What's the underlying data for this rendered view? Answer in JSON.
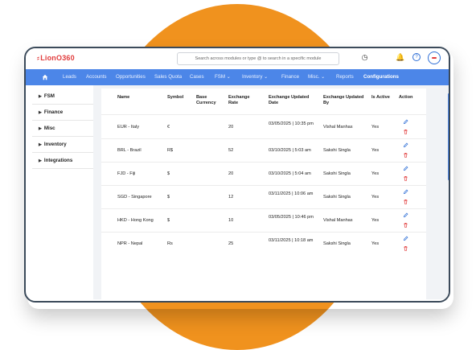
{
  "app": {
    "logo": "LionO360"
  },
  "search": {
    "placeholder": "Search across modules or type @ to search in a specific module"
  },
  "nav": [
    "Leads",
    "Accounts",
    "Opportunities",
    "Sales Quota",
    "Cases",
    "FSM",
    "Inventory",
    "Finance",
    "Misc.",
    "Reports",
    "Configurations"
  ],
  "nav_dropdowns": [
    "FSM",
    "Inventory",
    "Misc."
  ],
  "nav_active": "Configurations",
  "sidebar": [
    "FSM",
    "Finance",
    "Misc",
    "Inventory",
    "Integrations"
  ],
  "table": {
    "headers": [
      "Name",
      "Symbol",
      "Base Currency",
      "Exchange Rate",
      "Exchange Updated Date",
      "Exchange Updated By",
      "Is Active",
      "Action"
    ],
    "rows": [
      {
        "name": "EUR - Italy",
        "symbol": "€",
        "base": "",
        "rate": "20",
        "date": "03/05/2025 | 10:35 pm",
        "by": "Vishal Manhas",
        "active": "Yes"
      },
      {
        "name": "BRL - Brazil",
        "symbol": "R$",
        "base": "",
        "rate": "52",
        "date": "03/10/2025 | 5:03 am",
        "by": "Sakshi Singla",
        "active": "Yes"
      },
      {
        "name": "FJD - Fiji",
        "symbol": "$",
        "base": "",
        "rate": "20",
        "date": "03/10/2025 | 5:04 am",
        "by": "Sakshi Singla",
        "active": "Yes"
      },
      {
        "name": "SGD - Singapore",
        "symbol": "$",
        "base": "",
        "rate": "12",
        "date": "03/11/2025 | 10:06 am",
        "by": "Sakshi Singla",
        "active": "Yes"
      },
      {
        "name": "HKD - Hong Kong",
        "symbol": "$",
        "base": "",
        "rate": "10",
        "date": "03/05/2025 | 10:46 pm",
        "by": "Vishal Manhas",
        "active": "Yes"
      },
      {
        "name": "NPR - Nepal",
        "symbol": "Rs",
        "base": "",
        "rate": "25",
        "date": "03/11/2025 | 10:18 am",
        "by": "Sakshi Singla",
        "active": "Yes"
      }
    ]
  },
  "colors": {
    "accent": "#4c86e8",
    "brand": "#e13b3b",
    "backdrop": "#f0921e",
    "delete": "#e13b3b",
    "edit": "#2f6fd6"
  },
  "icons": {
    "home": "home-icon",
    "clock": "clock-icon",
    "bell": "bell-icon",
    "help": "help-icon",
    "edit": "pencil-icon",
    "delete": "trash-icon"
  }
}
